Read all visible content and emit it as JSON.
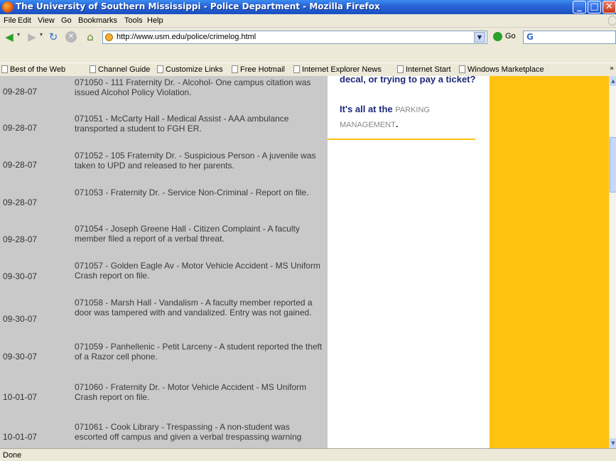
{
  "window": {
    "title": "The University of Southern Mississippi - Police Department - Mozilla Firefox",
    "minimize_label": "_",
    "maximize_label": "□",
    "close_label": "✕"
  },
  "menu": {
    "items": [
      "File",
      "Edit",
      "View",
      "Go",
      "Bookmarks",
      "Tools",
      "Help"
    ]
  },
  "nav": {
    "back_icon": "back-arrow-icon",
    "forward_icon": "forward-arrow-icon",
    "reload_icon": "reload-icon",
    "stop_icon": "stop-icon",
    "home_icon": "home-icon",
    "url": "http://www.usm.edu/police/crimelog.html",
    "go_label": "Go",
    "search_engine_glyph": "G"
  },
  "bookmarks": {
    "items": [
      "Best of the Web",
      "Channel Guide",
      "Customize Links",
      "Free Hotmail",
      "Internet Explorer News",
      "Internet Start",
      "Windows Marketplace"
    ],
    "more_label": "»"
  },
  "crime_log": {
    "rows": [
      {
        "date": "09-28-07",
        "text": "071050 - 111 Fraternity Dr. - Alcohol- One campus citation was issued Alcohol Policy Violation."
      },
      {
        "date": "09-28-07",
        "text": "071051 - McCarty Hall - Medical Assist - AAA ambulance transported a student to FGH ER."
      },
      {
        "date": "09-28-07",
        "text": "071052 - 105 Fraternity Dr. - Suspicious Person - A juvenile was taken to UPD and released to her parents."
      },
      {
        "date": "09-28-07",
        "text": "071053 - Fraternity Dr. - Service Non-Criminal - Report on file."
      },
      {
        "date": "09-28-07",
        "text": "071054 - Joseph Greene Hall - Citizen Complaint - A faculty member filed a report of a verbal threat."
      },
      {
        "date": "09-30-07",
        "text": "071057 - Golden Eagle Av - Motor Vehicle Accident - MS Uniform Crash report on file."
      },
      {
        "date": "09-30-07",
        "text": "071058 - Marsh Hall - Vandalism - A faculty member reported a door was tampered with and vandalized. Entry was not gained."
      },
      {
        "date": "09-30-07",
        "text": "071059 - Panhellenic - Petit Larceny - A student reported the theft of a Razor cell phone."
      },
      {
        "date": "10-01-07",
        "text": "071060 - Fraternity Dr. - Motor Vehicle Accident - MS Uniform Crash report on file."
      },
      {
        "date": "10-01-07",
        "text": "071061 - Cook Library - Trespassing - A non-student was escorted off campus and given a verbal trespassing warning"
      }
    ]
  },
  "sidebar": {
    "question": "decal, or trying to pay a ticket?",
    "lead": "It's all at the",
    "link": "PARKING MANAGEMENT",
    "period": "."
  },
  "status": {
    "text": "Done"
  },
  "colors": {
    "title_bar": "#2a66d8",
    "log_background": "#c9c9c9",
    "gold_panel": "#ffc20e",
    "sidebar_text": "#1c2a7a"
  }
}
